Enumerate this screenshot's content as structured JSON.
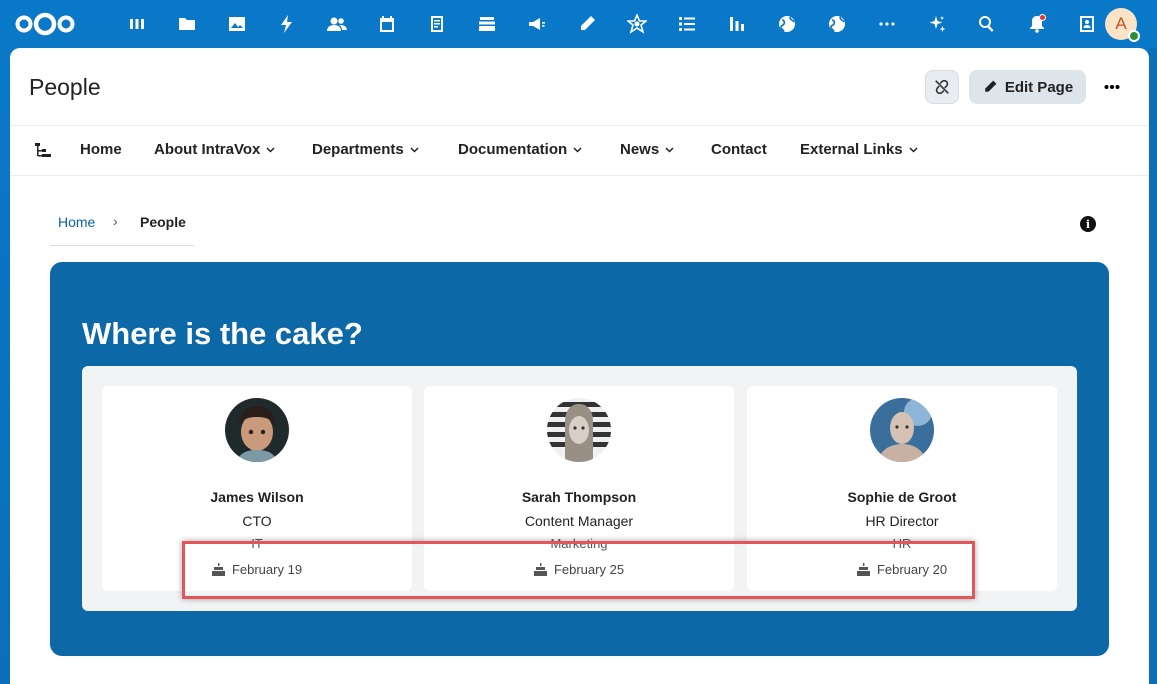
{
  "topbar": {
    "apps": [
      "dashboard-icon",
      "files-icon",
      "photos-icon",
      "activity-icon",
      "contacts-icon",
      "calendar-icon",
      "notes-icon",
      "deck-icon",
      "announcements-icon",
      "whiteboard-icon",
      "intravox-icon",
      "tasks-icon",
      "analytics-icon",
      "globe-icon",
      "globe-alt-icon",
      "more-apps-icon",
      "assistant-icon",
      "search-icon",
      "notifications-icon",
      "contacts-menu-icon"
    ],
    "user_initial": "A"
  },
  "page": {
    "title": "People",
    "edit_label": "Edit Page"
  },
  "nav": {
    "items": [
      {
        "label": "Home",
        "dropdown": false
      },
      {
        "label": "About IntraVox",
        "dropdown": true
      },
      {
        "label": "Departments",
        "dropdown": true
      },
      {
        "label": "Documentation",
        "dropdown": true
      },
      {
        "label": "News",
        "dropdown": true
      },
      {
        "label": "Contact",
        "dropdown": false
      },
      {
        "label": "External Links",
        "dropdown": true
      }
    ]
  },
  "breadcrumb": {
    "home": "Home",
    "separator": "›",
    "current": "People"
  },
  "hero": {
    "title": "Where is the cake?"
  },
  "people": [
    {
      "name": "James Wilson",
      "role": "CTO",
      "dept": "IT",
      "birthday": "February 19"
    },
    {
      "name": "Sarah Thompson",
      "role": "Content Manager",
      "dept": "Marketing",
      "birthday": "February 25"
    },
    {
      "name": "Sophie de Groot",
      "role": "HR Director",
      "dept": "HR",
      "birthday": "February 20"
    }
  ],
  "colors": {
    "brand": "#0b6fb8",
    "hero_bg": "#0c68a6",
    "link": "#0b63a6",
    "highlight": "#e0565b"
  }
}
